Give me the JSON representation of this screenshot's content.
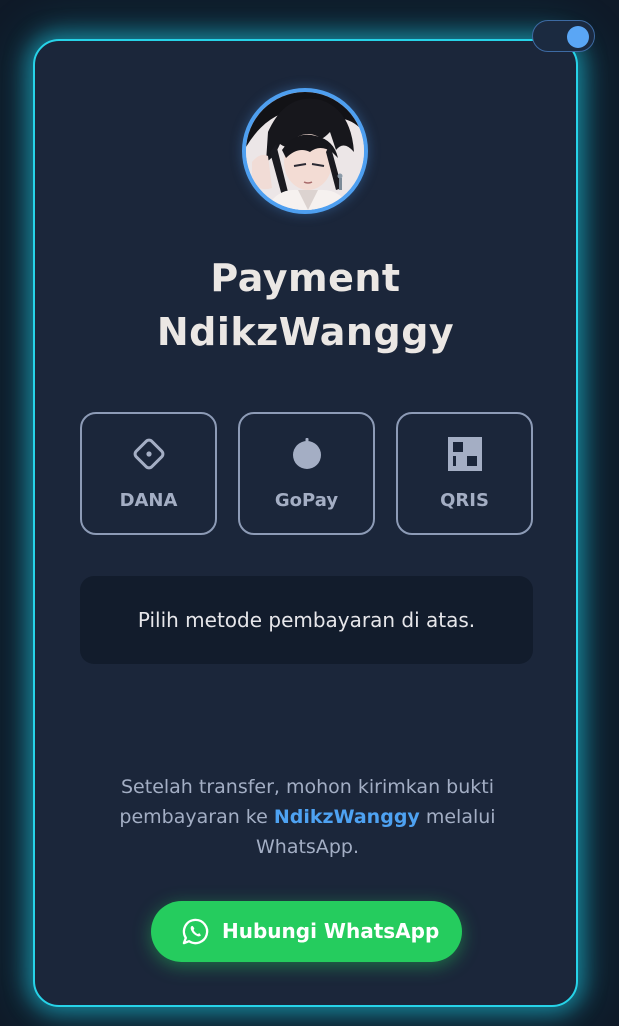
{
  "title": {
    "line1": "Payment",
    "line2": "NdikzWanggy"
  },
  "payment_methods": [
    {
      "label": "DANA",
      "icon": "dana-icon"
    },
    {
      "label": "GoPay",
      "icon": "gopay-icon"
    },
    {
      "label": "QRIS",
      "icon": "qris-icon"
    }
  ],
  "info_text": "Pilih metode pembayaran di atas.",
  "note": {
    "before": "Setelah transfer, mohon kirimkan bukti pembayaran ke ",
    "name": "NdikzWanggy",
    "after": " melalui WhatsApp."
  },
  "whatsapp_button": {
    "label": "Hubungi WhatsApp",
    "icon": "whatsapp-icon"
  },
  "theme_toggle": {
    "state": "on"
  },
  "colors": {
    "background": "#0f1a28",
    "card": "#1b263a",
    "card_glow": "#27d3e8",
    "accent_blue": "#4ea2f2",
    "whatsapp_green": "#25cc5e",
    "method_border": "#8d9bb6"
  }
}
